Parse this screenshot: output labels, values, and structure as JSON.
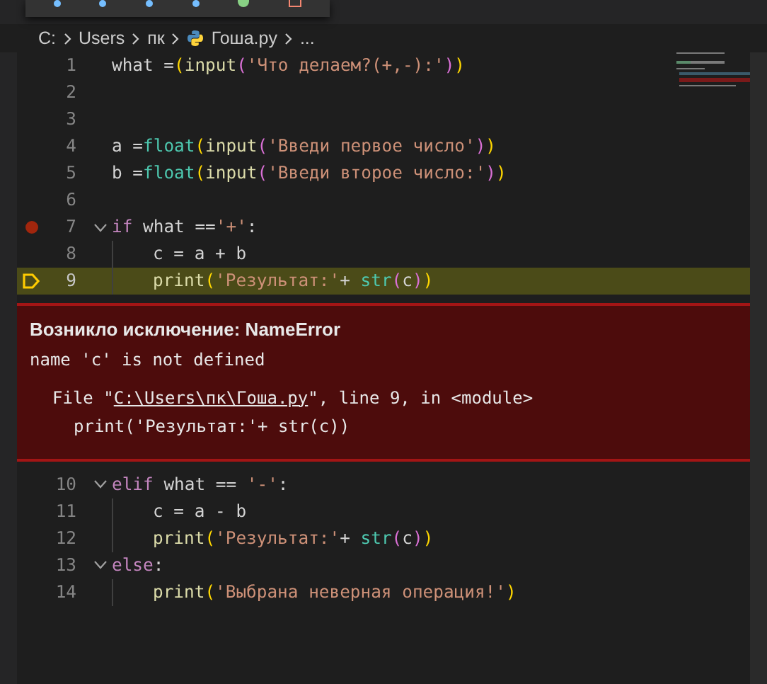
{
  "debug_toolbar": {
    "icons": [
      {
        "kind": "dot"
      },
      {
        "kind": "dot"
      },
      {
        "kind": "dot"
      },
      {
        "kind": "dot"
      },
      {
        "kind": "restart"
      },
      {
        "kind": "stop"
      }
    ]
  },
  "breadcrumbs": [
    {
      "label": "C:",
      "kind": "folder"
    },
    {
      "label": "Users",
      "kind": "folder"
    },
    {
      "label": "пк",
      "kind": "folder"
    },
    {
      "label": "Гоша.py",
      "kind": "python"
    },
    {
      "label": "...",
      "kind": "more"
    }
  ],
  "lines_before": [
    {
      "number": "1",
      "fold": false,
      "indent": false,
      "breakpoint": false,
      "current": false,
      "tokens": [
        {
          "text": "what =",
          "kind": "plain"
        },
        {
          "text": "(",
          "kind": "paren_outer"
        },
        {
          "text": "input",
          "kind": "function"
        },
        {
          "text": "(",
          "kind": "paren_inner"
        },
        {
          "text": "'Что делаем?(+,-):'",
          "kind": "string"
        },
        {
          "text": ")",
          "kind": "paren_inner"
        },
        {
          "text": ")",
          "kind": "paren_outer"
        }
      ]
    },
    {
      "number": "2",
      "fold": false,
      "indent": false,
      "breakpoint": false,
      "current": false
    },
    {
      "number": "3",
      "fold": false,
      "indent": false,
      "breakpoint": false,
      "current": false
    },
    {
      "number": "4",
      "fold": false,
      "indent": false,
      "breakpoint": false,
      "current": false,
      "tokens": [
        {
          "text": "a =",
          "kind": "plain"
        },
        {
          "text": "float",
          "kind": "builtin"
        },
        {
          "text": "(",
          "kind": "paren_outer"
        },
        {
          "text": "input",
          "kind": "function"
        },
        {
          "text": "(",
          "kind": "paren_inner"
        },
        {
          "text": "'Введи первое число'",
          "kind": "string"
        },
        {
          "text": ")",
          "kind": "paren_inner"
        },
        {
          "text": ")",
          "kind": "paren_outer"
        }
      ]
    },
    {
      "number": "5",
      "fold": false,
      "indent": false,
      "breakpoint": false,
      "current": false,
      "tokens": [
        {
          "text": "b =",
          "kind": "plain"
        },
        {
          "text": "float",
          "kind": "builtin"
        },
        {
          "text": "(",
          "kind": "paren_outer"
        },
        {
          "text": "input",
          "kind": "function"
        },
        {
          "text": "(",
          "kind": "paren_inner"
        },
        {
          "text": "'Введи второе число:'",
          "kind": "string"
        },
        {
          "text": ")",
          "kind": "paren_inner"
        },
        {
          "text": ")",
          "kind": "paren_outer"
        }
      ]
    },
    {
      "number": "6",
      "fold": false,
      "indent": false,
      "breakpoint": false,
      "current": false
    },
    {
      "number": "7",
      "fold": true,
      "indent": false,
      "breakpoint": true,
      "current": false,
      "tokens": [
        {
          "text": "if",
          "kind": "keyword"
        },
        {
          "text": " what ==",
          "kind": "plain"
        },
        {
          "text": "'+'",
          "kind": "string"
        },
        {
          "text": ":",
          "kind": "plain"
        }
      ]
    },
    {
      "number": "8",
      "fold": false,
      "indent": true,
      "breakpoint": false,
      "current": false,
      "tokens": [
        {
          "text": "c = a + b",
          "kind": "plain"
        }
      ]
    },
    {
      "number": "9",
      "fold": false,
      "indent": true,
      "breakpoint": false,
      "current": true,
      "tokens": [
        {
          "text": "print",
          "kind": "function"
        },
        {
          "text": "(",
          "kind": "paren_outer"
        },
        {
          "text": "'Результат:'",
          "kind": "string"
        },
        {
          "text": "+ ",
          "kind": "plain"
        },
        {
          "text": "str",
          "kind": "builtin"
        },
        {
          "text": "(",
          "kind": "paren_inner"
        },
        {
          "text": "c",
          "kind": "plain"
        },
        {
          "text": ")",
          "kind": "paren_inner"
        },
        {
          "text": ")",
          "kind": "paren_outer"
        }
      ]
    }
  ],
  "exception": {
    "title": "Возникло исключение: NameError",
    "message": "name 'c' is not defined",
    "trace_prefix": "File \"",
    "trace_link": "C:\\Users\\пк\\Гоша.py",
    "trace_suffix": "\", line 9, in <module>",
    "trace_code": "print('Результат:'+ str(c))"
  },
  "lines_after": [
    {
      "number": "10",
      "fold": true,
      "indent": false,
      "breakpoint": false,
      "current": false,
      "tokens": [
        {
          "text": "elif",
          "kind": "keyword"
        },
        {
          "text": " what == ",
          "kind": "plain"
        },
        {
          "text": "'-'",
          "kind": "string"
        },
        {
          "text": ":",
          "kind": "plain"
        }
      ]
    },
    {
      "number": "11",
      "fold": false,
      "indent": true,
      "breakpoint": false,
      "current": false,
      "tokens": [
        {
          "text": "c = a - b",
          "kind": "plain"
        }
      ]
    },
    {
      "number": "12",
      "fold": false,
      "indent": true,
      "breakpoint": false,
      "current": false,
      "tokens": [
        {
          "text": "print",
          "kind": "function"
        },
        {
          "text": "(",
          "kind": "paren_outer"
        },
        {
          "text": "'Результат:'",
          "kind": "string"
        },
        {
          "text": "+ ",
          "kind": "plain"
        },
        {
          "text": "str",
          "kind": "builtin"
        },
        {
          "text": "(",
          "kind": "paren_inner"
        },
        {
          "text": "c",
          "kind": "plain"
        },
        {
          "text": ")",
          "kind": "paren_inner"
        },
        {
          "text": ")",
          "kind": "paren_outer"
        }
      ]
    },
    {
      "number": "13",
      "fold": true,
      "indent": false,
      "breakpoint": false,
      "current": false,
      "tokens": [
        {
          "text": "else",
          "kind": "keyword"
        },
        {
          "text": ":",
          "kind": "plain"
        }
      ]
    },
    {
      "number": "14",
      "fold": false,
      "indent": true,
      "breakpoint": false,
      "current": false,
      "tokens": [
        {
          "text": "print",
          "kind": "function"
        },
        {
          "text": "(",
          "kind": "paren_outer"
        },
        {
          "text": "'Выбрана неверная операция!'",
          "kind": "string"
        },
        {
          "text": ")",
          "kind": "paren_outer"
        }
      ]
    }
  ]
}
